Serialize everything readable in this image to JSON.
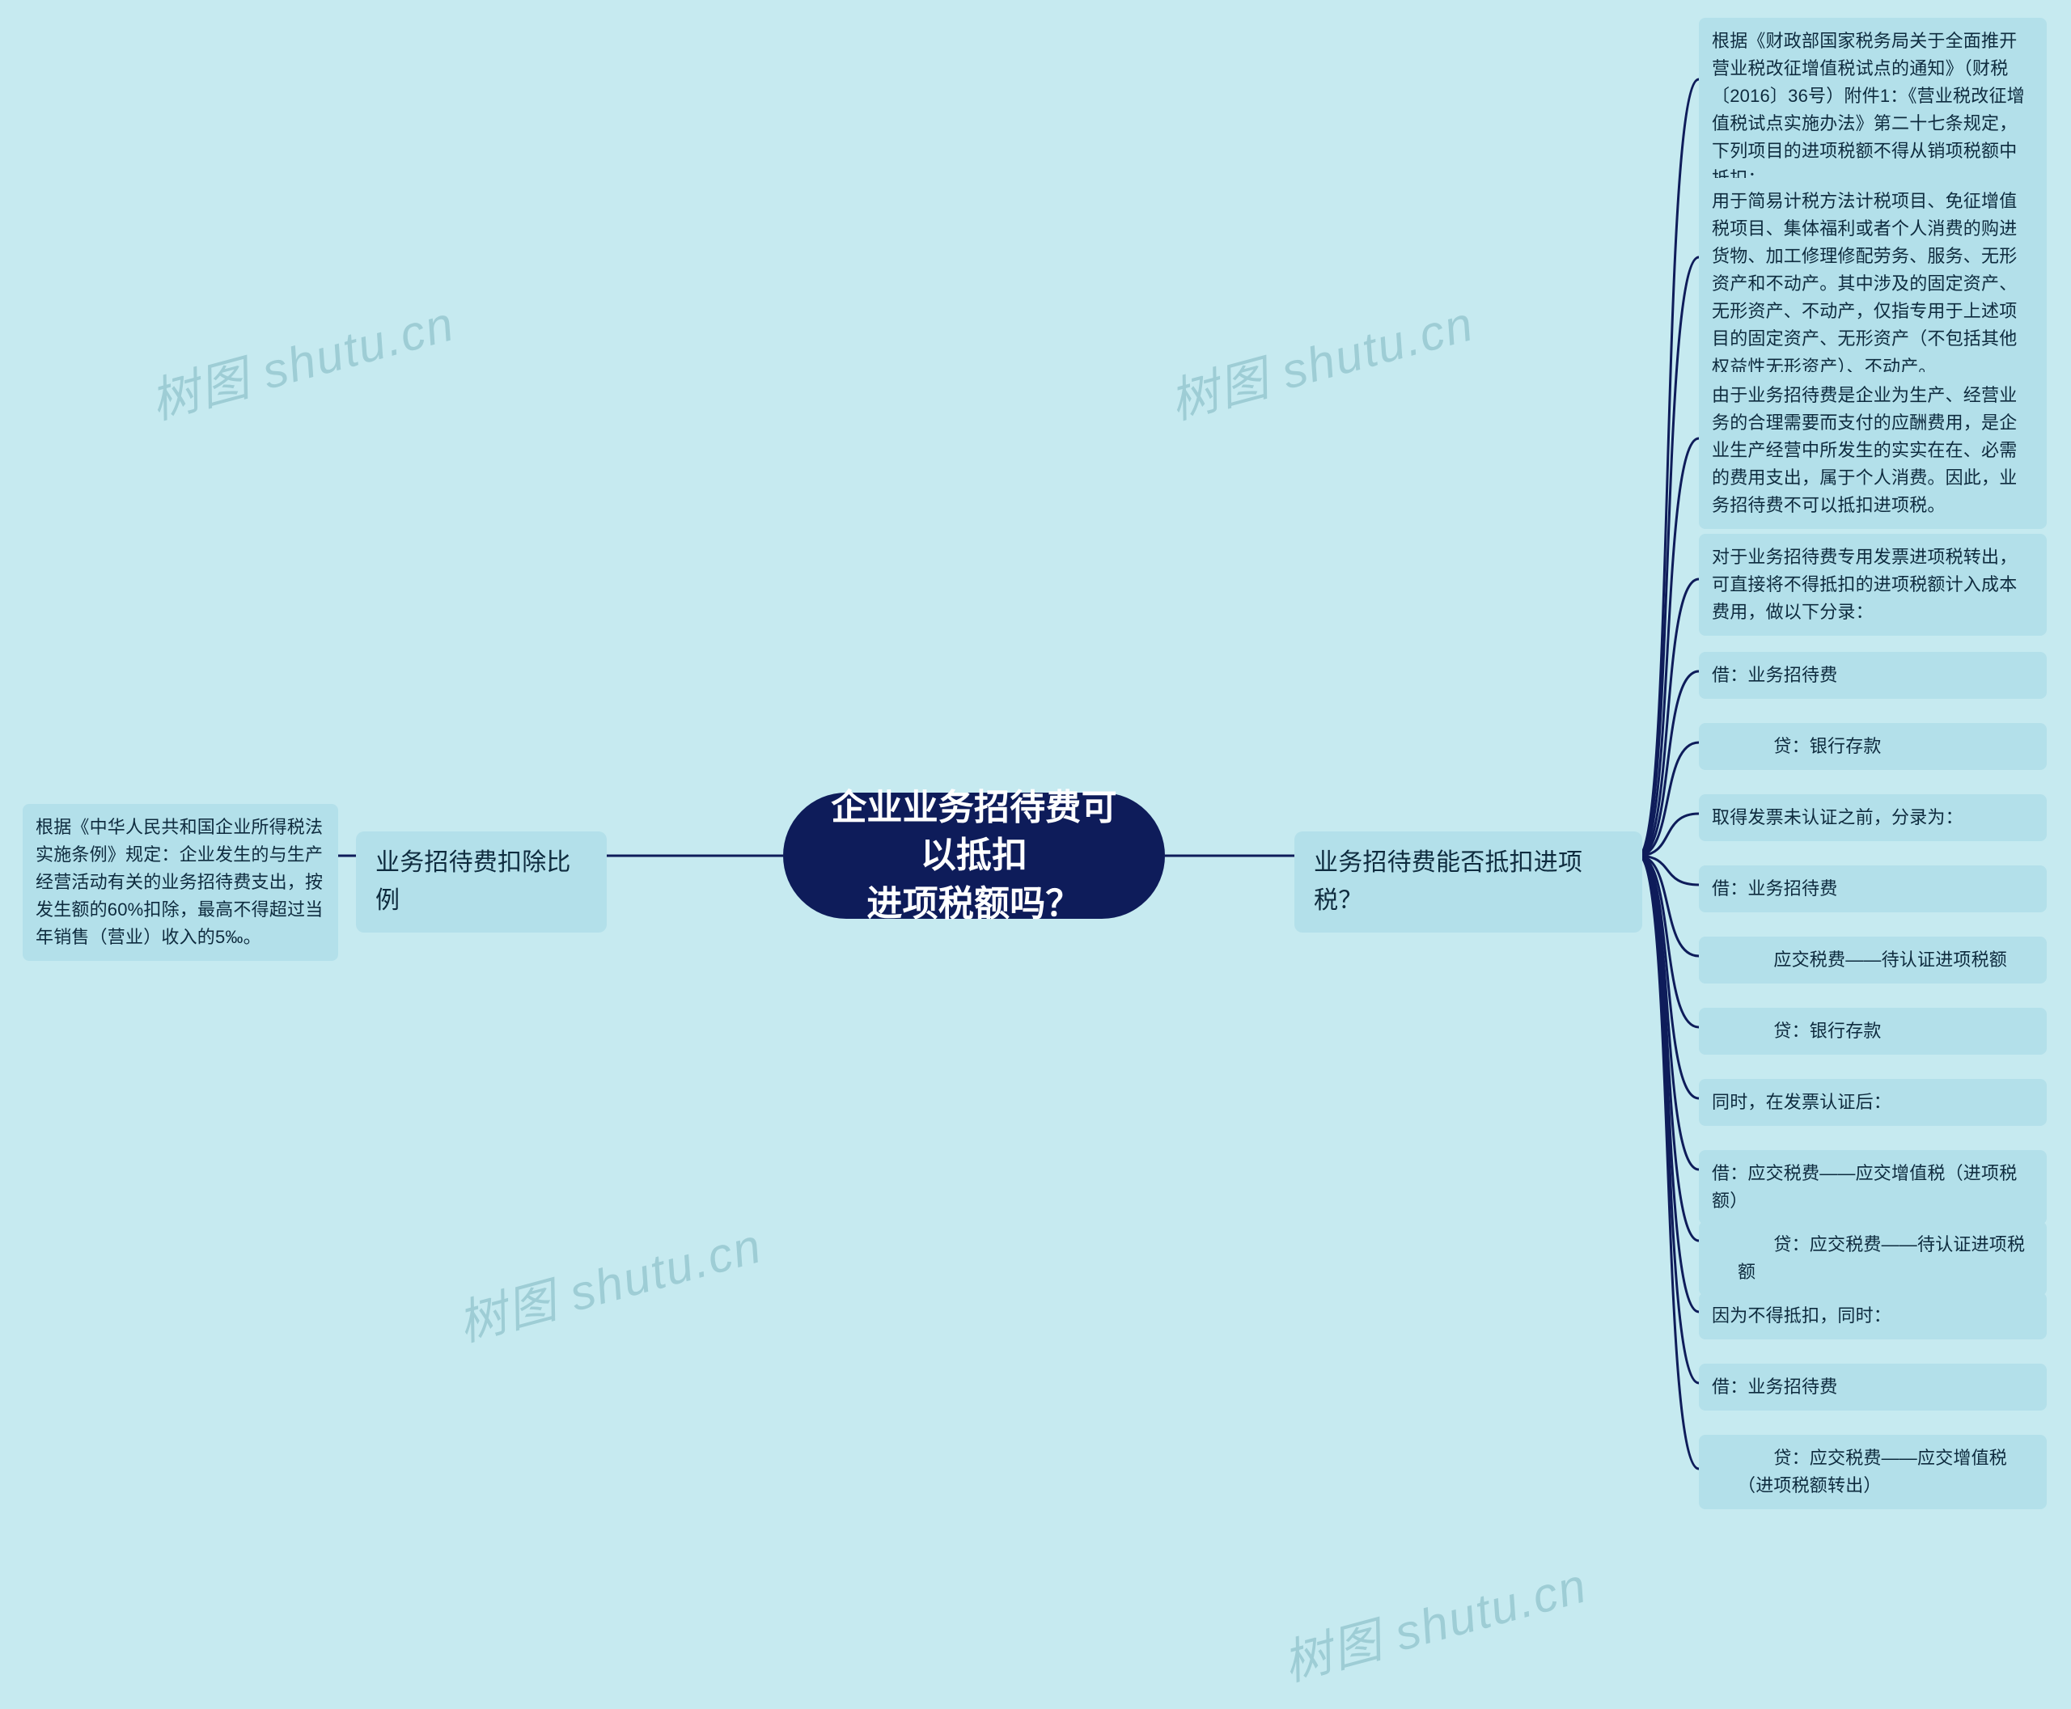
{
  "center": {
    "title_line1": "企业业务招待费可以抵扣",
    "title_line2": "进项税额吗？"
  },
  "left": {
    "branch_label": "业务招待费扣除比例",
    "leaf": "根据《中华人民共和国企业所得税法实施条例》规定：企业发生的与生产经营活动有关的业务招待费支出，按发生额的60%扣除，最高不得超过当年销售（营业）收入的5‰。"
  },
  "right": {
    "branch_label": "业务招待费能否抵扣进项税？",
    "items": [
      "根据《财政部国家税务局关于全面推开营业税改征增值税试点的通知》（财税〔2016〕36号）附件1：《营业税改征增值税试点实施办法》第二十七条规定，下列项目的进项税额不得从销项税额中抵扣：",
      "用于简易计税方法计税项目、免征增值税项目、集体福利或者个人消费的购进货物、加工修理修配劳务、服务、无形资产和不动产。其中涉及的固定资产、无形资产、不动产，仅指专用于上述项目的固定资产、无形资产（不包括其他权益性无形资产）、不动产。",
      "由于业务招待费是企业为生产、经营业务的合理需要而支付的应酬费用，是企业生产经营中所发生的实实在在、必需的费用支出，属于个人消费。因此，业务招待费不可以抵扣进项税。",
      "对于业务招待费专用发票进项税转出，可直接将不得抵扣的进项税额计入成本费用，做以下分录：",
      "借：业务招待费",
      "　　贷：银行存款",
      "取得发票未认证之前，分录为：",
      "借：业务招待费",
      "　　应交税费——待认证进项税额",
      "　　贷：银行存款",
      "同时，在发票认证后：",
      "借：应交税费——应交增值税（进项税额）",
      "　　贷：应交税费——待认证进项税额",
      "因为不得抵扣，同时：",
      "借：业务招待费",
      "　　贷：应交税费——应交增值税（进项税额转出）"
    ]
  },
  "watermark_text": "树图 shutu.cn"
}
